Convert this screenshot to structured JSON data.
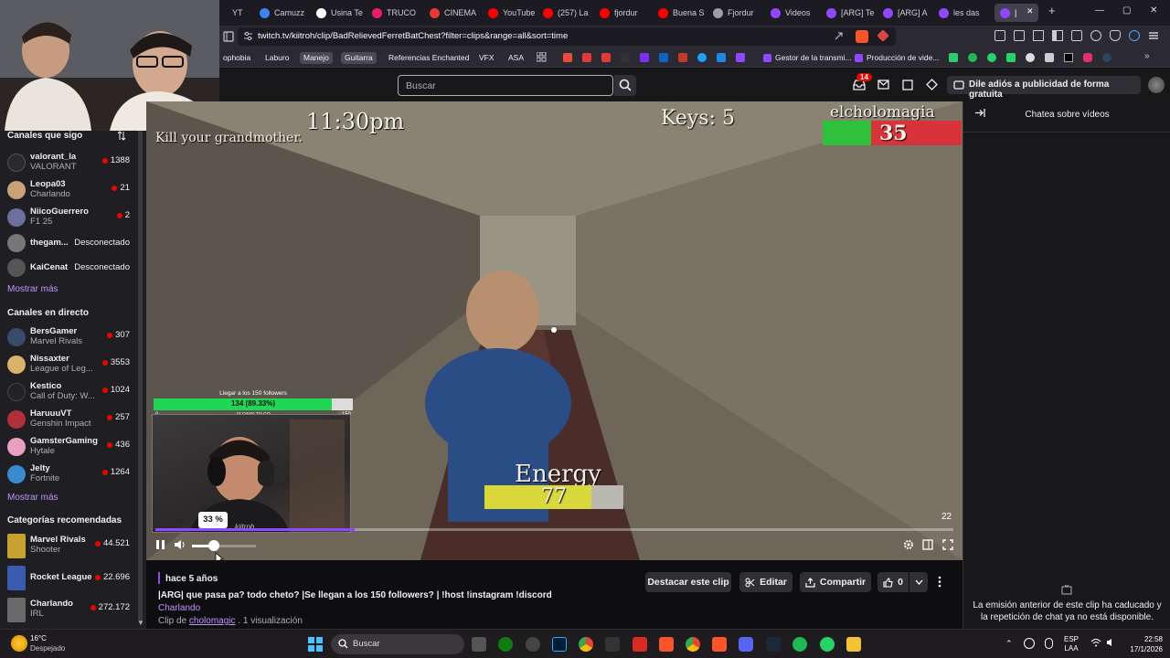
{
  "browser": {
    "tabs": [
      {
        "label": "YT",
        "color": "#c83a3a"
      },
      {
        "label": "Camuzz",
        "color": "#3b82f6"
      },
      {
        "label": "Usina Te",
        "color": "#ffffff"
      },
      {
        "label": "TRUCO",
        "color": "#e91e63"
      },
      {
        "label": "CINEMA",
        "color": "#e53935"
      },
      {
        "label": "YouTube",
        "color": "#ff0000"
      },
      {
        "label": "(257) La",
        "color": "#ff0000"
      },
      {
        "label": "fjordur",
        "color": "#ff0000"
      },
      {
        "label": "Buena S",
        "color": "#ff0000"
      },
      {
        "label": "Fjordur",
        "color": "#9aa0a6"
      },
      {
        "label": "Videos",
        "color": "#9146ff"
      },
      {
        "label": "[ARG] Te",
        "color": "#9146ff"
      },
      {
        "label": "[ARG] A",
        "color": "#9146ff"
      },
      {
        "label": "les das",
        "color": "#9146ff"
      },
      {
        "label": "|",
        "color": "#9146ff"
      }
    ],
    "url": "twitch.tv/kiitroh/clip/BadRelievedFerretBatChest?filter=clips&range=all&sort=time",
    "bookmarks": [
      {
        "label": "ophobia",
        "color": "#c7a4ff"
      },
      {
        "label": "Laburo",
        "color": "#f0a040"
      },
      {
        "label": "Manejo",
        "color": "#e6c84a"
      },
      {
        "label": "Guitarra",
        "color": "#d6d6d6"
      },
      {
        "label": "Referencias Enchanted",
        "color": "#e07070"
      },
      {
        "label": "VFX",
        "color": "#7ec4ff"
      },
      {
        "label": "ASA",
        "color": "#b6f09c"
      },
      {
        "label": "Gestor de la transmi...",
        "color": "#e0e0e0"
      },
      {
        "label": "Producción de vide...",
        "color": "#e0e0e0"
      }
    ]
  },
  "topnav": {
    "search_placeholder": "Buscar",
    "notification_count": "14",
    "adfree_label": "Dile adiós a publicidad de forma gratuita"
  },
  "sidebar": {
    "followed_title": "Canales que sigo",
    "followed": [
      {
        "name": "valorant_la",
        "game": "VALORANT",
        "viewers": "1388",
        "color": "#2a2a2a"
      },
      {
        "name": "Leopa03",
        "game": "Charlando",
        "viewers": "21",
        "color": "#c9a27b"
      },
      {
        "name": "NiicoGuerrero",
        "game": "F1 25",
        "viewers": "2",
        "color": "#6d6f9e"
      },
      {
        "name": "thegam...",
        "status": "Desconectado",
        "color": "#777777"
      },
      {
        "name": "KaiCenat",
        "status": "Desconectado",
        "color": "#555555"
      }
    ],
    "show_more_1": "Mostrar más",
    "live_title": "Canales en directo",
    "live": [
      {
        "name": "BersGamer",
        "game": "Marvel Rivals",
        "viewers": "307",
        "color": "#3a4a6a"
      },
      {
        "name": "Nissaxter",
        "game": "League of Leg...",
        "viewers": "3553",
        "color": "#d9b36a"
      },
      {
        "name": "Kestico",
        "game": "Call of Duty: W...",
        "viewers": "1024",
        "color": "#222222"
      },
      {
        "name": "HaruuuVT",
        "game": "Genshin Impact",
        "viewers": "257",
        "color": "#b0303a"
      },
      {
        "name": "GamsterGaming",
        "game": "Hytale",
        "viewers": "436",
        "color": "#e8a0c0"
      },
      {
        "name": "Jelty",
        "game": "Fortnite",
        "viewers": "1264",
        "color": "#3a8ad0"
      }
    ],
    "show_more_2": "Mostrar más",
    "categories_title": "Categorías recomendadas",
    "categories": [
      {
        "name": "Marvel Rivals",
        "sub": "Shooter",
        "viewers": "44.521",
        "color": "#c8a030"
      },
      {
        "name": "Rocket League",
        "sub": "",
        "viewers": "22.696",
        "color": "#3a5ab0"
      },
      {
        "name": "Charlando",
        "sub": "IRL",
        "viewers": "272.172",
        "color": "#6a6a6a"
      }
    ]
  },
  "player": {
    "game_text_1": "Kill your grandmother.",
    "clock": "11:30pm",
    "keys": "Keys: 5",
    "player_name": "elcholomagia",
    "hp_value": "35",
    "hp_fraction": 0.35,
    "energy_label": "Energy",
    "energy_value": "77",
    "energy_fraction": 0.77,
    "followers_title": "Llegar a los 150 followers",
    "followers_progress": "134 (89.33%)",
    "followers_fraction": 0.8933,
    "followers_min": "0",
    "followers_max": "150",
    "followers_days": "41 DAYS TO GO",
    "overlay_name": "kiitroh",
    "progress_fraction": 0.25,
    "time_remaining": "22",
    "volume_tip": "33 %",
    "volume_fraction": 0.33
  },
  "clip": {
    "age": "hace 5 años",
    "title": "|ARG| que pasa pa? todo cheto? |Se llegan a los 150 followers? | !host !instagram !discord",
    "category": "Charlando",
    "clip_by_prefix": "Clip de",
    "clipper": "cholomagic",
    "views": ". 1 visualización",
    "highlight_label": "Destacar este clip",
    "edit_label": "Editar",
    "share_label": "Compartir",
    "like_count": "0"
  },
  "chat": {
    "header": "Chatea sobre vídeos",
    "message": "La emisión anterior de este clip ha caducado y la repetición de chat ya no está disponible."
  },
  "taskbar": {
    "weather_temp": "16°C",
    "weather_desc": "Despejado",
    "search_label": "Buscar",
    "lang_1": "ESP",
    "lang_2": "LAA",
    "time": "22:58",
    "date": "17/1/2026"
  }
}
